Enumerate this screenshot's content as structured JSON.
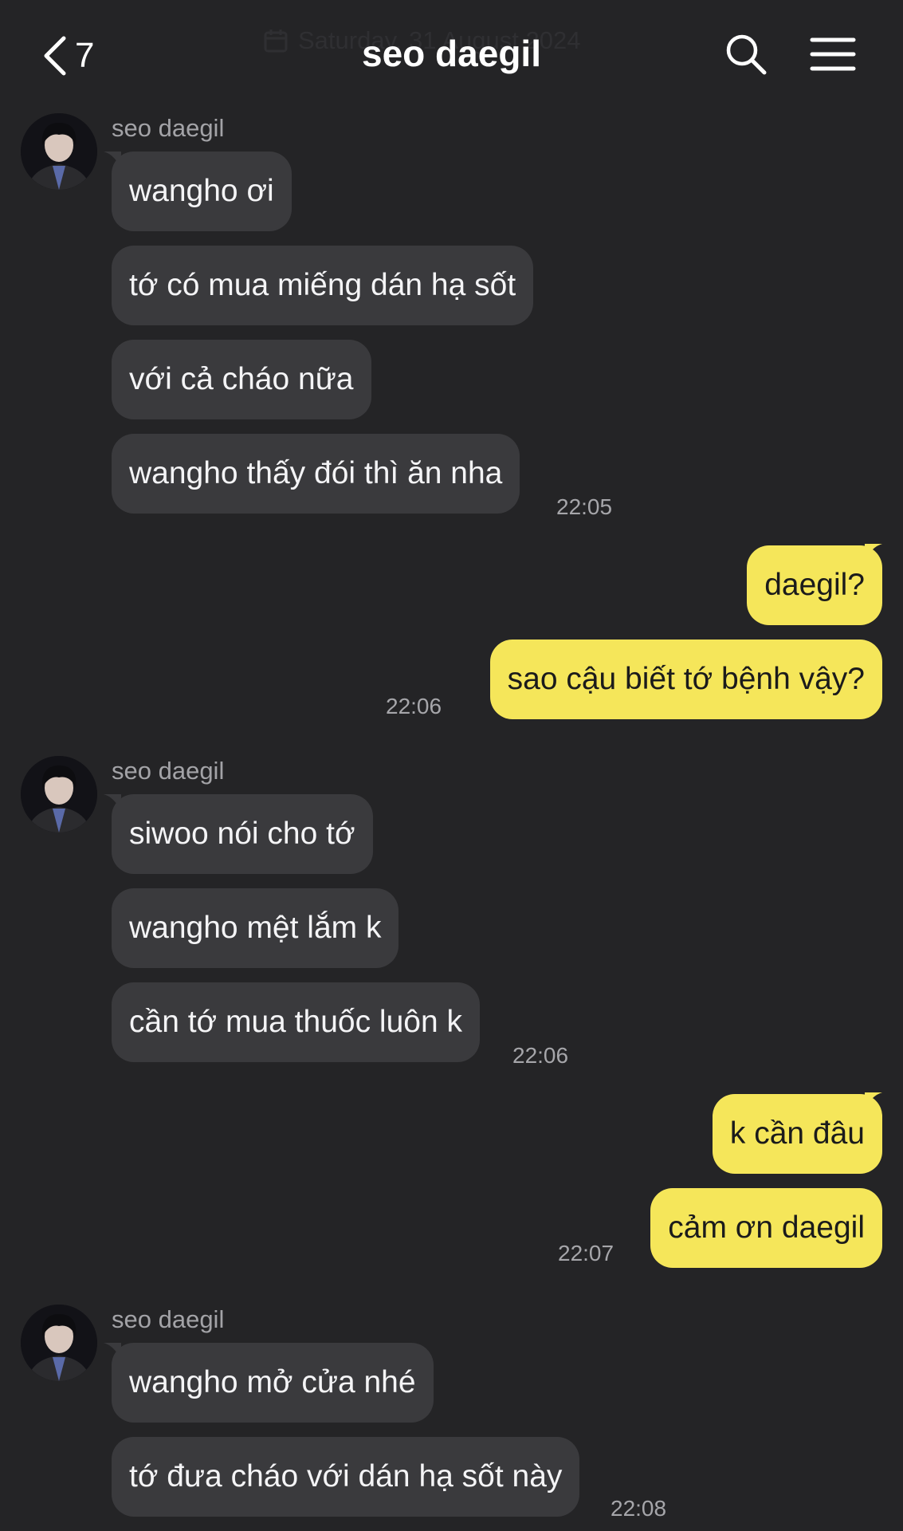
{
  "header": {
    "title": "seo daegil",
    "back_count": "7",
    "date_label": "Saturday, 31 August 2024"
  },
  "theme": {
    "background": "#242426",
    "incoming_bubble": "#3a3a3d",
    "outgoing_bubble": "#f5e65a"
  },
  "icons": {
    "back": "chevron-left-icon",
    "search": "search-icon",
    "menu": "hamburger-menu-icon",
    "calendar": "calendar-icon"
  },
  "messages": {
    "g1": {
      "sender": "seo daegil",
      "m1": "wangho ơi",
      "m2": "tớ có mua miếng dán hạ sốt",
      "m3": "với cả cháo nữa",
      "m4": "wangho thấy đói thì ăn nha",
      "time": "22:05"
    },
    "g2": {
      "m1": "daegil?",
      "m2": "sao cậu biết tớ bệnh vậy?",
      "time": "22:06"
    },
    "g3": {
      "sender": "seo daegil",
      "m1": "siwoo nói cho tớ",
      "m2": "wangho mệt lắm k",
      "m3": "cần tớ mua thuốc luôn k",
      "time": "22:06"
    },
    "g4": {
      "m1": "k cần đâu",
      "m2": "cảm ơn daegil",
      "time": "22:07"
    },
    "g5": {
      "sender": "seo daegil",
      "m1": "wangho mở cửa nhé",
      "m2": "tớ đưa cháo với dán hạ sốt này",
      "time": "22:08"
    }
  }
}
